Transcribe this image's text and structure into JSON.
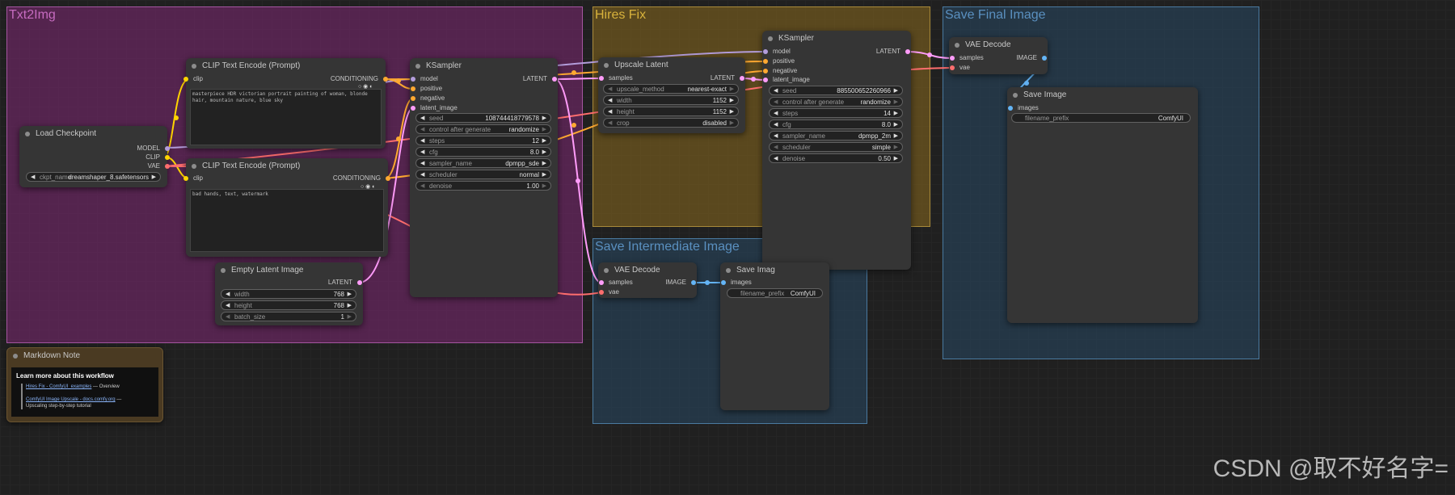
{
  "groups": {
    "txt2img": "Txt2Img",
    "hires_fix": "Hires Fix",
    "save_final": "Save Final Image",
    "save_intermediate": "Save Intermediate Image"
  },
  "colors": {
    "model_link": "#b39ddb",
    "clip_link": "#ffd500",
    "conditioning_link": "#ffa931",
    "latent_link": "#ff9cf9",
    "vae_link": "#ff6e6e",
    "image_link": "#64b5f6"
  },
  "load_checkpoint": {
    "title": "Load Checkpoint",
    "outputs": [
      "MODEL",
      "CLIP",
      "VAE"
    ],
    "ckpt_label": "ckpt_name",
    "ckpt_value": "dreamshaper_8.safetensors"
  },
  "clip_pos": {
    "title": "CLIP Text Encode (Prompt)",
    "input": "clip",
    "output": "CONDITIONING",
    "text": "masterpiece HDR victorian portrait painting of woman, blonde hair, mountain nature, blue sky"
  },
  "clip_neg": {
    "title": "CLIP Text Encode (Prompt)",
    "input": "clip",
    "output": "CONDITIONING",
    "text": "bad hands, text, watermark"
  },
  "empty_latent": {
    "title": "Empty Latent Image",
    "output": "LATENT",
    "widgets": [
      {
        "label": "width",
        "value": "768"
      },
      {
        "label": "height",
        "value": "768"
      },
      {
        "label": "batch_size",
        "value": "1"
      }
    ]
  },
  "ksampler1": {
    "title": "KSampler",
    "inputs": [
      "model",
      "positive",
      "negative",
      "latent_image"
    ],
    "output": "LATENT",
    "widgets": [
      {
        "label": "seed",
        "value": "108744418779578"
      },
      {
        "label": "control after generate",
        "value": "randomize"
      },
      {
        "label": "steps",
        "value": "12"
      },
      {
        "label": "cfg",
        "value": "8.0"
      },
      {
        "label": "sampler_name",
        "value": "dpmpp_sde"
      },
      {
        "label": "scheduler",
        "value": "normal"
      },
      {
        "label": "denoise",
        "value": "1.00"
      }
    ]
  },
  "upscale_latent": {
    "title": "Upscale Latent",
    "input": "samples",
    "output": "LATENT",
    "widgets": [
      {
        "label": "upscale_method",
        "value": "nearest-exact"
      },
      {
        "label": "width",
        "value": "1152"
      },
      {
        "label": "height",
        "value": "1152"
      },
      {
        "label": "crop",
        "value": "disabled"
      }
    ]
  },
  "ksampler2": {
    "title": "KSampler",
    "inputs": [
      "model",
      "positive",
      "negative",
      "latent_image"
    ],
    "output": "LATENT",
    "widgets": [
      {
        "label": "seed",
        "value": "885500652260966"
      },
      {
        "label": "control after generate",
        "value": "randomize"
      },
      {
        "label": "steps",
        "value": "14"
      },
      {
        "label": "cfg",
        "value": "8.0"
      },
      {
        "label": "sampler_name",
        "value": "dpmpp_2m"
      },
      {
        "label": "scheduler",
        "value": "simple"
      },
      {
        "label": "denoise",
        "value": "0.50"
      }
    ]
  },
  "vae_decode_final": {
    "title": "VAE Decode",
    "inputs": [
      "samples",
      "vae"
    ],
    "output": "IMAGE"
  },
  "save_image_final": {
    "title": "Save Image",
    "input": "images",
    "prefix_label": "filename_prefix",
    "prefix_value": "ComfyUI"
  },
  "vae_decode_inter": {
    "title": "VAE Decode",
    "inputs": [
      "samples",
      "vae"
    ],
    "output": "IMAGE"
  },
  "save_image_inter": {
    "title": "Save Imag",
    "input": "images",
    "prefix_label": "filename_prefix",
    "prefix_value": "ComfyUI"
  },
  "markdown_note": {
    "title": "Markdown Note",
    "heading": "Learn more about this workflow",
    "link1": "Hires Fix - ComfyUI_examples",
    "link1_suffix": " — Overview",
    "link2": "ComfyUI Image Upscale - docs.comfy.org",
    "link2_suffix": " —",
    "line3": "Upscaling step-by-step tutorial"
  },
  "watermark": "CSDN @取不好名字="
}
